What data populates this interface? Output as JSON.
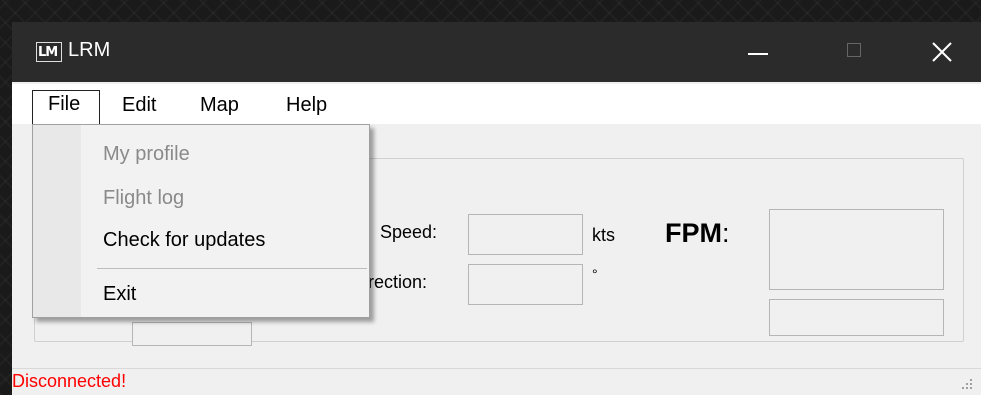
{
  "window": {
    "logo": "LM",
    "title": "LRM",
    "minimize_icon": "minimize-icon",
    "maximize_icon": "maximize-icon",
    "close_icon": "close-icon"
  },
  "menubar": {
    "items": [
      {
        "label": "File"
      },
      {
        "label": "Edit"
      },
      {
        "label": "Map"
      },
      {
        "label": "Help"
      }
    ]
  },
  "file_menu": {
    "items": [
      {
        "label": "My profile",
        "enabled": false
      },
      {
        "label": "Flight log",
        "enabled": false
      },
      {
        "label": "Check for updates",
        "enabled": true
      },
      {
        "label": "Exit",
        "enabled": true
      }
    ]
  },
  "panel": {
    "speed_label": "Speed:",
    "speed_unit": "kts",
    "direction_label": "irection:",
    "direction_unit": "°",
    "fpm_label": "FPM",
    "fpm_colon": ":"
  },
  "status": {
    "text": "Disconnected!",
    "color": "#ff0000"
  }
}
